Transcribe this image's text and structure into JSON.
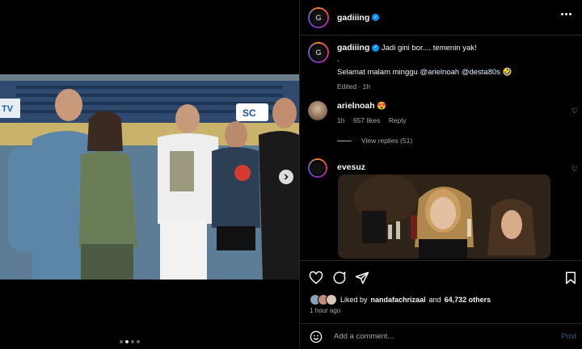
{
  "post": {
    "author": "gadiiing",
    "caption_line1": "Jadi gini bor.... temenin yak!",
    "caption_line2": ".",
    "caption_line3_prefix": "Selamat malam minggu ",
    "mention1": "@arielnoah",
    "mention2": "@desta80s",
    "caption_emoji": "🤣",
    "edited": "Edited · 1h",
    "photo_sign": "SC",
    "photo_tv": "TV"
  },
  "comments": [
    {
      "user": "arielnoah",
      "emoji": "😍",
      "time": "1h",
      "likes": "657 likes",
      "reply_label": "Reply",
      "view_replies": "View replies (51)"
    },
    {
      "user": "evesuz"
    }
  ],
  "stats": {
    "liked_by_prefix": "Liked by",
    "liked_by_user": "nandafachrizaal",
    "liked_by_suffix": "and",
    "others": "64,732 others",
    "time_ago": "1 hour ago"
  },
  "comment_box": {
    "placeholder": "Add a comment...",
    "post_label": "Post"
  },
  "carousel": {
    "total": 4,
    "active": 2
  }
}
